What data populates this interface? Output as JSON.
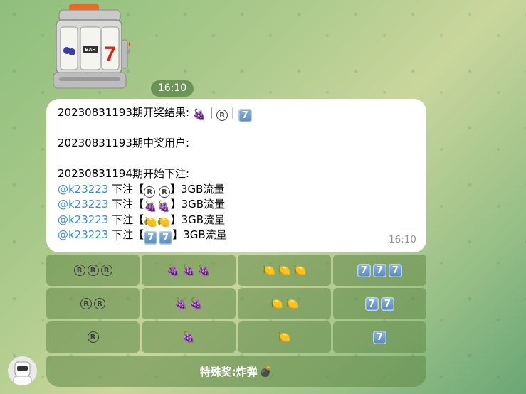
{
  "sticker": {
    "time": "16:10"
  },
  "message": {
    "lines": [
      {
        "text": "20230831193期开奖结果: ",
        "emojis": [
          "grapes",
          "r-symbol",
          "seven"
        ]
      },
      {
        "text": ""
      },
      {
        "text": "20230831193期中奖用户:"
      },
      {
        "text": ""
      },
      {
        "text": "20230831194期开始下注:"
      }
    ],
    "bets": [
      {
        "user": "@k23223",
        "prefix": " 下注【",
        "emojis": [
          "r-symbol",
          "r-symbol"
        ],
        "suffix": "】3GB流量"
      },
      {
        "user": "@k23223",
        "prefix": " 下注【",
        "emojis": [
          "grapes",
          "grapes"
        ],
        "suffix": "】3GB流量"
      },
      {
        "user": "@k23223",
        "prefix": " 下注【",
        "emojis": [
          "lemon",
          "lemon"
        ],
        "suffix": "】3GB流量"
      },
      {
        "user": "@k23223",
        "prefix": " 下注【",
        "emojis": [
          "seven",
          "seven"
        ],
        "suffix": "】3GB流量"
      }
    ],
    "time": "16:10"
  },
  "keyboard": {
    "rows": [
      [
        {
          "emoji": "r-symbol",
          "count": 3
        },
        {
          "emoji": "grapes",
          "count": 3
        },
        {
          "emoji": "lemon",
          "count": 3
        },
        {
          "emoji": "seven",
          "count": 3
        }
      ],
      [
        {
          "emoji": "r-symbol",
          "count": 2
        },
        {
          "emoji": "grapes",
          "count": 2
        },
        {
          "emoji": "lemon",
          "count": 2
        },
        {
          "emoji": "seven",
          "count": 2
        }
      ],
      [
        {
          "emoji": "r-symbol",
          "count": 1
        },
        {
          "emoji": "grapes",
          "count": 1
        },
        {
          "emoji": "lemon",
          "count": 1
        },
        {
          "emoji": "seven",
          "count": 1
        }
      ]
    ],
    "special": {
      "label": "特殊奖:炸弹",
      "emoji": "bomb"
    }
  },
  "glyphs": {
    "r": "R",
    "seven": "7",
    "grapes": "🍇",
    "lemon": "🍋",
    "bomb": "💣"
  }
}
